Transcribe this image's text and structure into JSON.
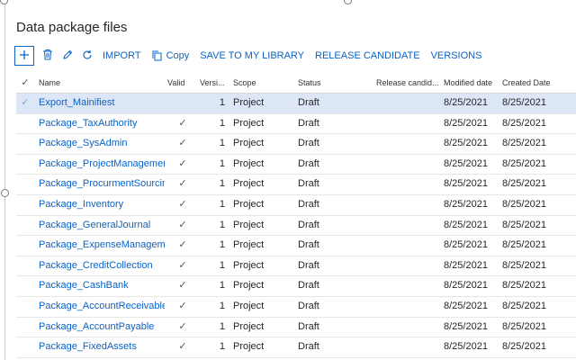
{
  "title": "Data package files",
  "toolbar": {
    "new_icon": "plus-icon",
    "delete_icon": "trash-icon",
    "edit_icon": "pencil-icon",
    "refresh_icon": "refresh-icon",
    "import_label": "IMPORT",
    "copy_label": "Copy",
    "save_library_label": "SAVE TO MY LIBRARY",
    "release_candidate_label": "RELEASE CANDIDATE",
    "versions_label": "VERSIONS"
  },
  "accent_color": "#0b62c4",
  "selected_row_color": "#dce6f7",
  "columns": {
    "select": "✓",
    "name": "Name",
    "valid": "Valid",
    "version": "Versi...",
    "scope": "Scope",
    "status": "Status",
    "release": "Release candid...",
    "modified": "Modified date",
    "created": "Created Date"
  },
  "rows": [
    {
      "name": "Export_Mainifiest",
      "valid": "",
      "version": "1",
      "scope": "Project",
      "status": "Draft",
      "release": "",
      "modified": "8/25/2021",
      "created": "8/25/2021",
      "selected": true
    },
    {
      "name": "Package_TaxAuthority",
      "valid": "✓",
      "version": "1",
      "scope": "Project",
      "status": "Draft",
      "release": "",
      "modified": "8/25/2021",
      "created": "8/25/2021"
    },
    {
      "name": "Package_SysAdmin",
      "valid": "✓",
      "version": "1",
      "scope": "Project",
      "status": "Draft",
      "release": "",
      "modified": "8/25/2021",
      "created": "8/25/2021"
    },
    {
      "name": "Package_ProjectManagement",
      "valid": "✓",
      "version": "1",
      "scope": "Project",
      "status": "Draft",
      "release": "",
      "modified": "8/25/2021",
      "created": "8/25/2021"
    },
    {
      "name": "Package_ProcurmentSourcing",
      "valid": "✓",
      "version": "1",
      "scope": "Project",
      "status": "Draft",
      "release": "",
      "modified": "8/25/2021",
      "created": "8/25/2021"
    },
    {
      "name": "Package_Inventory",
      "valid": "✓",
      "version": "1",
      "scope": "Project",
      "status": "Draft",
      "release": "",
      "modified": "8/25/2021",
      "created": "8/25/2021"
    },
    {
      "name": "Package_GeneralJournal",
      "valid": "✓",
      "version": "1",
      "scope": "Project",
      "status": "Draft",
      "release": "",
      "modified": "8/25/2021",
      "created": "8/25/2021"
    },
    {
      "name": "Package_ExpenseManagement",
      "valid": "✓",
      "version": "1",
      "scope": "Project",
      "status": "Draft",
      "release": "",
      "modified": "8/25/2021",
      "created": "8/25/2021"
    },
    {
      "name": "Package_CreditCollection",
      "valid": "✓",
      "version": "1",
      "scope": "Project",
      "status": "Draft",
      "release": "",
      "modified": "8/25/2021",
      "created": "8/25/2021"
    },
    {
      "name": "Package_CashBank",
      "valid": "✓",
      "version": "1",
      "scope": "Project",
      "status": "Draft",
      "release": "",
      "modified": "8/25/2021",
      "created": "8/25/2021"
    },
    {
      "name": "Package_AccountReceivable",
      "valid": "✓",
      "version": "1",
      "scope": "Project",
      "status": "Draft",
      "release": "",
      "modified": "8/25/2021",
      "created": "8/25/2021"
    },
    {
      "name": "Package_AccountPayable",
      "valid": "✓",
      "version": "1",
      "scope": "Project",
      "status": "Draft",
      "release": "",
      "modified": "8/25/2021",
      "created": "8/25/2021"
    },
    {
      "name": "Package_FixedAssets",
      "valid": "✓",
      "version": "1",
      "scope": "Project",
      "status": "Draft",
      "release": "",
      "modified": "8/25/2021",
      "created": "8/25/2021"
    }
  ]
}
